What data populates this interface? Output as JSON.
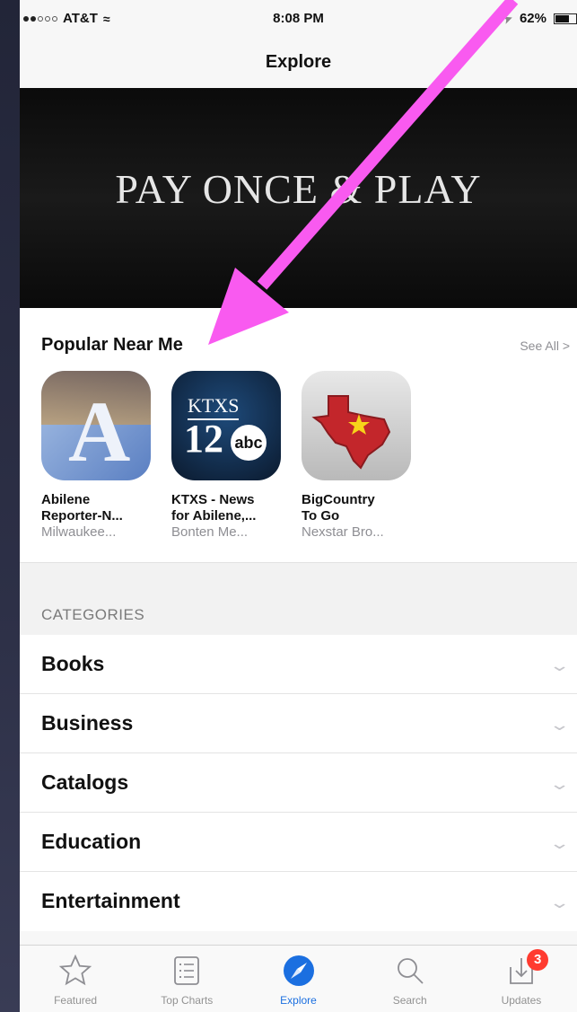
{
  "status_bar": {
    "carrier": "AT&T",
    "time": "8:08 PM",
    "battery": "62%"
  },
  "nav": {
    "title": "Explore"
  },
  "banner": {
    "title": "PAY ONCE & PLAY"
  },
  "popular": {
    "title": "Popular Near Me",
    "see_all": "See All >",
    "apps": [
      {
        "name_line1": "Abilene",
        "name_line2": "Reporter-N...",
        "developer": "Milwaukee..."
      },
      {
        "name_line1": "KTXS - News",
        "name_line2": "for Abilene,...",
        "developer": "Bonten Me..."
      },
      {
        "name_line1": "BigCountry",
        "name_line2": "To Go",
        "developer": "Nexstar Bro..."
      }
    ],
    "icon_text": {
      "abilene_letter": "A",
      "ktxs": "KTXS",
      "ktxs_number": "12",
      "ktxs_abc": "abc"
    }
  },
  "categories": {
    "header": "CATEGORIES",
    "items": [
      "Books",
      "Business",
      "Catalogs",
      "Education",
      "Entertainment"
    ]
  },
  "tab_bar": {
    "tabs": [
      {
        "label": "Featured",
        "icon": "star-icon"
      },
      {
        "label": "Top Charts",
        "icon": "list-icon"
      },
      {
        "label": "Explore",
        "icon": "compass-icon",
        "active": true
      },
      {
        "label": "Search",
        "icon": "search-icon"
      },
      {
        "label": "Updates",
        "icon": "download-tray-icon"
      }
    ],
    "updates_badge": "3"
  },
  "colors": {
    "accent": "#1b6fe0",
    "badge": "#ff3b30",
    "annotation_arrow": "#f95af0"
  }
}
